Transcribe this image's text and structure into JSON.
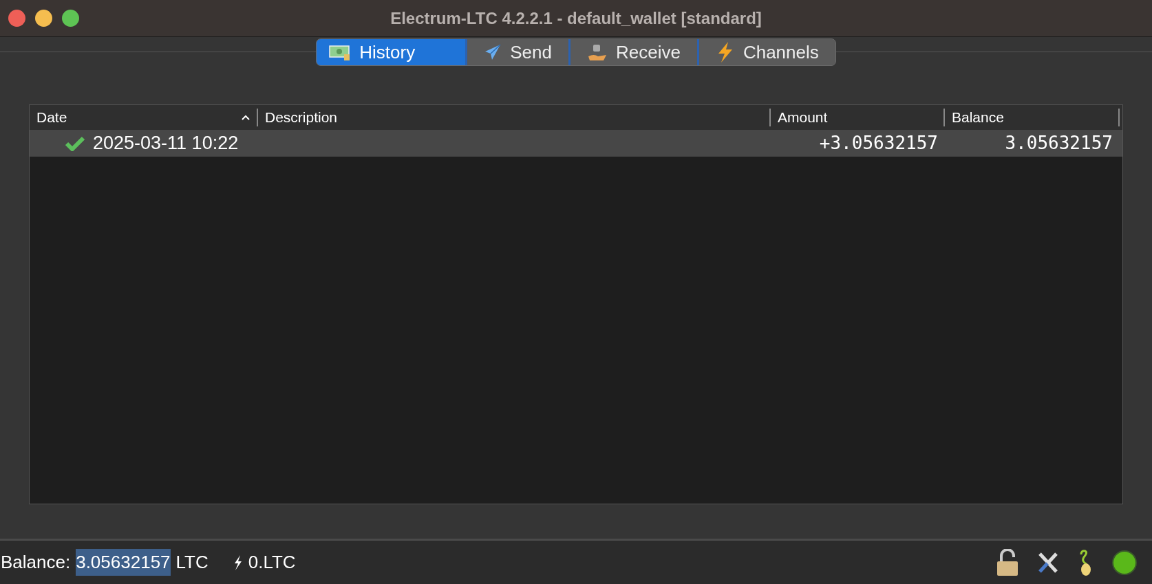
{
  "window": {
    "title": "Electrum-LTC 4.2.2.1  -  default_wallet  [standard]"
  },
  "tabs": [
    {
      "label": "History",
      "selected": true,
      "kind": "history"
    },
    {
      "label": "Send",
      "selected": false,
      "kind": "send"
    },
    {
      "label": "Receive",
      "selected": false,
      "kind": "receive"
    },
    {
      "label": "Channels",
      "selected": false,
      "kind": "channels"
    }
  ],
  "table": {
    "columns": [
      {
        "label": "Date",
        "sorted": true
      },
      {
        "label": "Description",
        "sorted": false
      },
      {
        "label": "Amount",
        "sorted": false
      },
      {
        "label": "Balance",
        "sorted": false
      }
    ],
    "rows": [
      {
        "date": "2025-03-11 10:22",
        "description": "",
        "amount": "+3.05632157",
        "balance": "3.05632157",
        "confirmed": true,
        "selected": true
      }
    ]
  },
  "status_bar": {
    "balance_label": "Balance:",
    "balance_value": "3.05632157",
    "balance_unit": "LTC",
    "lightning_balance": "0.LTC"
  }
}
